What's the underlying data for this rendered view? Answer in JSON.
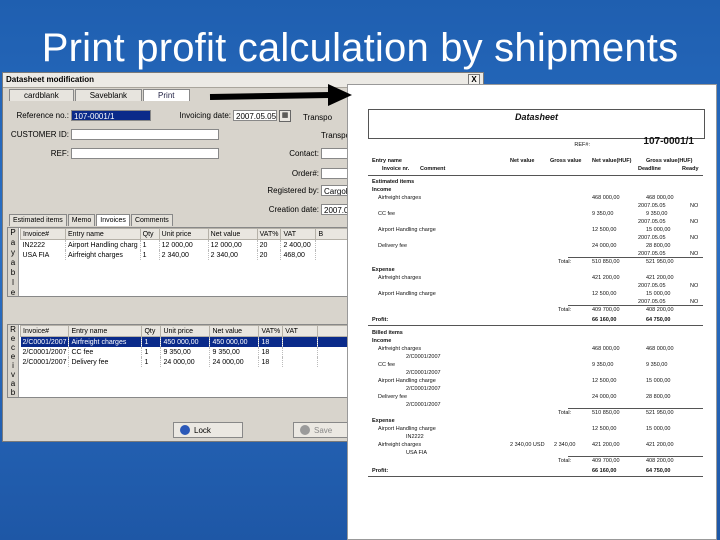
{
  "slide": {
    "title": "Print profit calculation by shipments"
  },
  "dialog": {
    "title": "Datasheet modification",
    "close": "X",
    "tabs": [
      "cardblank",
      "Saveblank",
      "Print"
    ],
    "fields": {
      "reference_label": "Reference no.:",
      "reference_value": "107-0001/1",
      "invoicing_label": "Invoicing date:",
      "invoicing_value": "2007.05.05",
      "transp_label_1": "Transpo",
      "customer_label": "CUSTOMER ID:",
      "transp_label_2": "Transpo",
      "ref_label": "REF:",
      "contact_label": "Contact:",
      "order_label": "Order#:",
      "registered_label": "Registered by:",
      "registered_value": "Cargologic",
      "creation_label": "Creation date:",
      "creation_value": "2007.05"
    },
    "subtabs": [
      "Estimated items",
      "Memo",
      "Invoices",
      "Comments"
    ],
    "side_top": [
      "P",
      "a",
      "y",
      "a",
      "b",
      "l",
      "e"
    ],
    "side_bottom": [
      "R",
      "e",
      "c",
      "e",
      "i",
      "v",
      "a",
      "b"
    ],
    "grid_headers": [
      "Invoice#",
      "Entry name",
      "Qty",
      "Unit price",
      "Net value",
      "VAT%",
      "VAT",
      "B"
    ],
    "payable_rows": [
      [
        "IN2222",
        "Airport Handling charg",
        "1",
        "12 000,00",
        "12 000,00",
        "20",
        "2 400,00"
      ],
      [
        "USA FIA",
        "Airfreight charges",
        "1",
        "2 340,00",
        "2 340,00",
        "20",
        "468,00"
      ]
    ],
    "receivable_rows": [
      [
        "2/C0001/2007",
        "Airfreight charges",
        "1",
        "450 000,00",
        "450 000,00",
        "18",
        ""
      ],
      [
        "2/C0001/2007",
        "CC fee",
        "1",
        "9 350,00",
        "9 350,00",
        "18",
        ""
      ],
      [
        "2/C0001/2007",
        "Delivery fee",
        "1",
        "24 000,00",
        "24 000,00",
        "18",
        ""
      ]
    ],
    "buttons": {
      "lock": "Lock",
      "save": "Save"
    }
  },
  "sheet": {
    "title": "Datasheet",
    "ref_label": "REF#:",
    "ref_value": "107-0001/1",
    "columns": [
      "Entry name",
      "Invoice nr.",
      "Comment",
      "Net value",
      "Gross value",
      "Net value(HUF)",
      "Gross value(HUF)",
      "Deadline",
      "Ready"
    ],
    "sections": [
      {
        "label": "Estimated items",
        "rows": [
          [
            "Income",
            "",
            "",
            "",
            "",
            ""
          ],
          [
            "Airfreight charges",
            "",
            "",
            "468 000,00",
            "468 000,00",
            ""
          ],
          [
            "",
            "",
            "",
            "2007.05.05",
            "",
            "NO"
          ],
          [
            "CC fee",
            "",
            "",
            "9 350,00",
            "9 350,00",
            ""
          ],
          [
            "",
            "",
            "",
            "2007.05.05",
            "",
            "NO"
          ],
          [
            "Airport Handling charge",
            "",
            "",
            "12 500,00",
            "15 000,00",
            ""
          ],
          [
            "",
            "",
            "",
            "2007.05.05",
            "",
            "NO"
          ],
          [
            "Delivery fee",
            "",
            "",
            "24 000,00",
            "28 800,00",
            ""
          ],
          [
            "",
            "",
            "",
            "2007.05.05",
            "",
            "NO"
          ],
          [
            "",
            "Total:",
            "",
            "510 850,00",
            "521 950,00",
            ""
          ],
          [
            "Expense",
            "",
            "",
            "",
            "",
            ""
          ],
          [
            "Airfreight charges",
            "",
            "",
            "421 200,00",
            "421 200,00",
            ""
          ],
          [
            "",
            "",
            "",
            "2007.05.05",
            "",
            "NO"
          ],
          [
            "Airport Handling charge",
            "",
            "",
            "12 500,00",
            "15 000,00",
            ""
          ],
          [
            "",
            "",
            "",
            "2007.05.05",
            "",
            "NO"
          ],
          [
            "",
            "Total:",
            "",
            "409 700,00",
            "408 200,00",
            ""
          ]
        ]
      },
      {
        "label": "Profit:",
        "rows": [
          [
            "",
            "",
            "",
            "66 160,00",
            "64 750,00",
            ""
          ]
        ]
      },
      {
        "label": "Billed items",
        "rows": [
          [
            "Income",
            "",
            "",
            "",
            "",
            ""
          ],
          [
            "Airfreight charges",
            "",
            "",
            "468 000,00",
            "468 000,00",
            ""
          ],
          [
            "2/C0001/2007",
            "",
            "",
            "",
            "",
            ""
          ],
          [
            "CC fee",
            "",
            "",
            "9 350,00",
            "9 350,00",
            ""
          ],
          [
            "2/C0001/2007",
            "",
            "",
            "",
            "",
            ""
          ],
          [
            "Airport Handling charge",
            "",
            "",
            "12 500,00",
            "15 000,00",
            ""
          ],
          [
            "2/C0001/2007",
            "",
            "",
            "",
            "",
            ""
          ],
          [
            "Delivery fee",
            "",
            "",
            "24 000,00",
            "28 800,00",
            ""
          ],
          [
            "2/C0001/2007",
            "",
            "",
            "",
            "",
            ""
          ],
          [
            "",
            "Total:",
            "",
            "510 850,00",
            "521 950,00",
            ""
          ],
          [
            "Expense",
            "",
            "",
            "",
            "",
            ""
          ],
          [
            "Airport Handling charge",
            "",
            "",
            "12 500,00",
            "15 000,00",
            ""
          ],
          [
            "IN2222",
            "",
            "",
            "",
            "",
            ""
          ],
          [
            "Airfreight charges",
            "2 340,00 USD",
            "2 340,00",
            "421 200,00",
            "421 200,00",
            ""
          ],
          [
            "USA FIA",
            "",
            "",
            "",
            "",
            ""
          ],
          [
            "",
            "Total:",
            "",
            "409 700,00",
            "408 200,00",
            ""
          ]
        ]
      },
      {
        "label": "Profit:",
        "rows": [
          [
            "",
            "",
            "",
            "66 160,00",
            "64 750,00",
            ""
          ]
        ]
      }
    ]
  },
  "colors": {
    "background": "#2a6fc4",
    "selection": "#0a2a8a",
    "arrow": "#000000"
  }
}
